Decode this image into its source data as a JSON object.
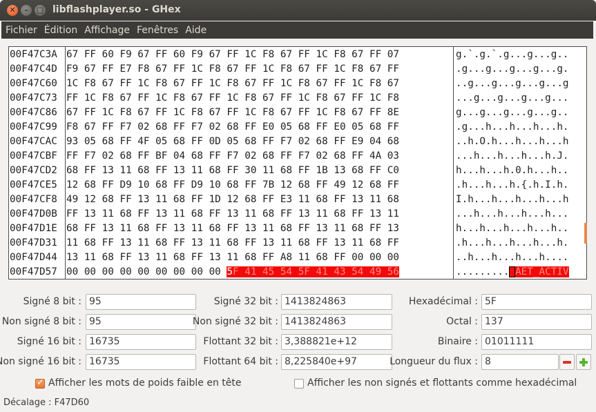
{
  "window": {
    "title": "libflashplayer.so - GHex",
    "close_glyph": "✕",
    "min_glyph": "–",
    "max_glyph": "□"
  },
  "menu": [
    "Fichier",
    "Édition",
    "Affichage",
    "Fenêtres",
    "Aide"
  ],
  "hex": {
    "offsets": [
      "00F47C3A",
      "00F47C4D",
      "00F47C60",
      "00F47C73",
      "00F47C86",
      "00F47C99",
      "00F47CAC",
      "00F47CBF",
      "00F47CD2",
      "00F47CE5",
      "00F47CF8",
      "00F47D0B",
      "00F47D1E",
      "00F47D31",
      "00F47D44",
      "00F47D57"
    ],
    "rows": [
      "67 FF 60 F9 67 FF 60 F9 67 FF 1C F8 67 FF 1C F8 67 FF 07",
      "F9 67 FF E7 F8 67 FF 1C F8 67 FF 1C F8 67 FF 1C F8 67 FF",
      "1C F8 67 FF 1C F8 67 FF 1C F8 67 FF 1C F8 67 FF 1C F8 67",
      "FF 1C F8 67 FF 1C F8 67 FF 1C F8 67 FF 1C F8 67 FF 1C F8",
      "67 FF 1C F8 67 FF 1C F8 67 FF 1C F8 67 FF 1C F8 67 FF 8E",
      "F8 67 FF F7 02 68 FF F7 02 68 FF E0 05 68 FF E0 05 68 FF",
      "93 05 68 FF 4F 05 68 FF 0D 05 68 FF F7 02 68 FF E9 04 68",
      "FF F7 02 68 FF BF 04 68 FF F7 02 68 FF F7 02 68 FF 4A 03",
      "68 FF 13 11 68 FF 13 11 68 FF 30 11 68 FF 1B 13 68 FF C0",
      "12 68 FF D9 10 68 FF D9 10 68 FF 7B 12 68 FF 49 12 68 FF",
      "49 12 68 FF 13 11 68 FF 1D 12 68 FF E3 11 68 FF 13 11 68",
      "FF 13 11 68 FF 13 11 68 FF 13 11 68 FF 13 11 68 FF 13 11",
      "68 FF 13 11 68 FF 13 11 68 FF 13 11 68 FF 13 11 68 FF 13",
      "11 68 FF 13 11 68 FF 13 11 68 FF 13 11 68 FF 13 11 68 FF",
      "13 11 68 FF 13 11 68 FF 13 11 68 FF A8 11 68 FF 00 00 00",
      "00 00 00 00 00 00 00 00 00 "
    ],
    "last_row_selected_hex": "5F 41 45 54 5F 41 43 54 49 56",
    "ascii_rows": [
      "g.`.g.`.g...g...g..",
      ".g...g...g...g...g.",
      "..g...g...g...g...g",
      "...g...g...g...g...",
      "g...g...g...g...g..",
      ".g...h...h...h...h.",
      "..h.O.h...h...h...h",
      "...h...h...h...h.J.",
      "h...h...h.0.h...h..",
      ".h...h...h.{.h.I.h.",
      "I.h...h...h...h...h",
      "...h...h...h...h...",
      "h...h...h...h...h..",
      ".h...h...h...h...h.",
      "..h...h...h...h....",
      "........."
    ],
    "last_row_selected_ascii": "_AET_ACTIV"
  },
  "fields": {
    "signe8_label": "Signé 8 bit :",
    "signe8": "95",
    "nonsigne8_label": "Non signé 8 bit :",
    "nonsigne8": "95",
    "signe16_label": "Signé 16 bit :",
    "signe16": "16735",
    "nonsigne16_label": "Non signé 16 bit :",
    "nonsigne16": "16735",
    "signe32_label": "Signé 32 bit :",
    "signe32": "1413824863",
    "nonsigne32_label": "Non signé 32 bit :",
    "nonsigne32": "1413824863",
    "flottant32_label": "Flottant 32 bit :",
    "flottant32": "3,388821e+12",
    "flottant64_label": "Flottant 64 bit :",
    "flottant64": "8,225840e+97",
    "hexa_label": "Hexadécimal :",
    "hexa": "5F",
    "octal_label": "Octal :",
    "octal": "137",
    "binaire_label": "Binaire :",
    "binaire": "01011111",
    "flux_label": "Longueur du flux :",
    "flux": "8"
  },
  "options": {
    "little_endian_label": "Afficher les mots de poids faible en tête",
    "little_endian_checked": true,
    "unsigned_hex_label": "Afficher les non signés et flottants comme hexadécimal",
    "unsigned_hex_checked": false
  },
  "status": "Décalage : F47D60",
  "colors": {
    "selection": "#f20a0a",
    "titlebar": "#3c3b37",
    "accent": "#e67a35"
  }
}
